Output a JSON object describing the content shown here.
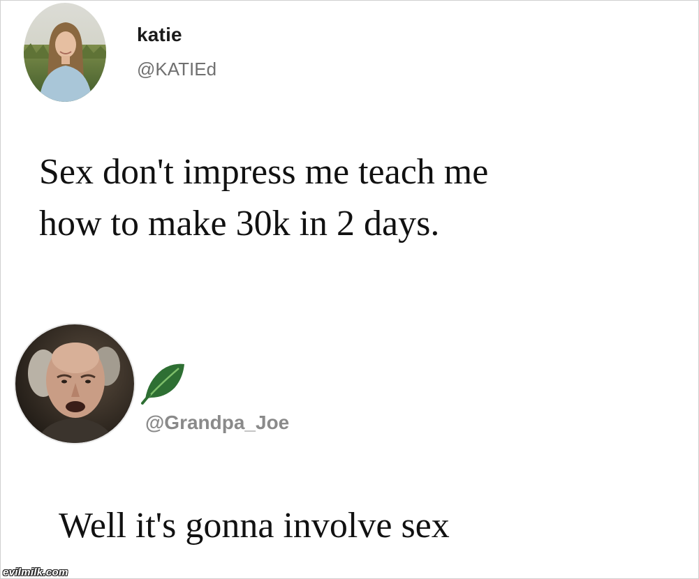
{
  "tweet1": {
    "display_name": "katie",
    "handle": "@KATIEd",
    "text_line1": "Sex don't impress me teach me",
    "text_line2": "how to make 30k in 2 days.",
    "avatar_icon": "profile-photo-woman-in-field"
  },
  "tweet2": {
    "handle": "@Grandpa_Joe",
    "text": "Well it's gonna involve sex",
    "avatar_icon": "profile-photo-old-man",
    "badge_icon": "leaf-icon",
    "badge_color": "#2e6f33"
  },
  "watermark": "evilmilk.com"
}
